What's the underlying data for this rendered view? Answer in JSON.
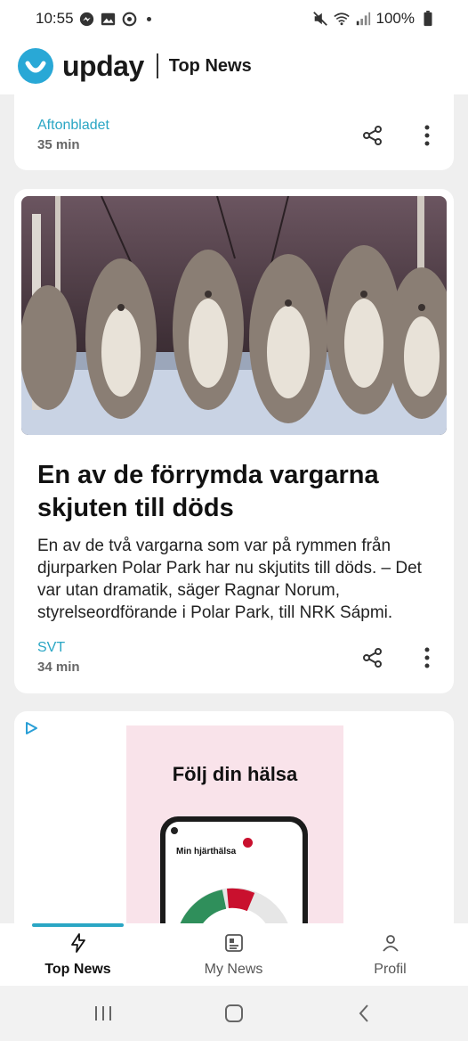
{
  "status_bar": {
    "time": "10:55",
    "battery": "100%",
    "left_icons": [
      "messenger-icon",
      "gallery-icon",
      "app-icon"
    ],
    "right_icons": [
      "mute-icon",
      "wifi-icon",
      "signal-icon",
      "battery-icon"
    ]
  },
  "app_bar": {
    "brand": "upday",
    "section": "Top News",
    "brand_color": "#29a8d6"
  },
  "articles": [
    {
      "source": "Aftonbladet",
      "time": "35 min"
    },
    {
      "title": "En av de förrymda vargarna skjuten till döds",
      "summary": "En av de två vargarna som var på rymmen från djurparken Polar Park har nu skjutits till döds. – Det var utan dramatik, säger Ragnar Norum, styrelseordförande i Polar Park, till NRK Sápmi.",
      "source": "SVT",
      "time": "34 min"
    }
  ],
  "ad": {
    "headline": "Följ din hälsa",
    "phone_screen_title": "Min hjärthälsa"
  },
  "bottom_nav": {
    "items": [
      {
        "label": "Top News",
        "icon": "lightning-icon",
        "active": true
      },
      {
        "label": "My News",
        "icon": "news-icon",
        "active": false
      },
      {
        "label": "Profil",
        "icon": "person-icon",
        "active": false
      }
    ]
  },
  "colors": {
    "accent": "#2aa6c4",
    "badge": "#c9102e"
  }
}
